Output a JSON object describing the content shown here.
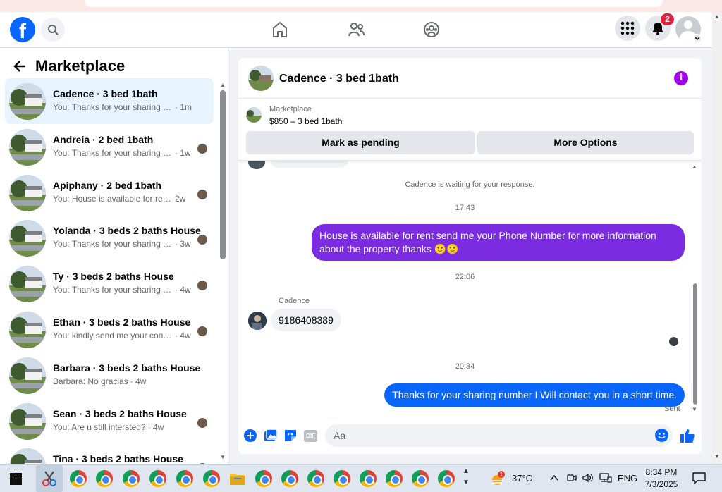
{
  "nav": {
    "logo": "f",
    "notification_count": "2"
  },
  "sidebar": {
    "title": "Marketplace",
    "conversations": [
      {
        "title": "Cadence · 3 bed 1bath",
        "preview": "You: Thanks for your sharing num...",
        "time": "· 1m",
        "active": true
      },
      {
        "title": "Andreia · 2 bed 1bath",
        "preview": "You: Thanks for your sharing nu...",
        "time": "· 1w"
      },
      {
        "title": "Apiphany · 2 bed 1bath",
        "preview": "You: House is available for rent sen...",
        "time": "2w"
      },
      {
        "title": "Yolanda · 3 beds 2 baths House",
        "preview": "You: Thanks for your sharing nu...",
        "time": "· 3w"
      },
      {
        "title": "Ty · 3 beds 2 baths House",
        "preview": "You: Thanks for your sharing nu...",
        "time": "· 4w"
      },
      {
        "title": "Ethan · 3 beds 2 baths House",
        "preview": "You: kindly send me your conta...",
        "time": "· 4w"
      },
      {
        "title": "Barbara · 3 beds 2 baths House",
        "preview": "Barbara: No gracias",
        "time": "· 4w"
      },
      {
        "title": "Sean · 3 beds 2 baths House",
        "preview": "You: Are u still intersted?",
        "time": "· 4w"
      },
      {
        "title": "Tina · 3 beds 2 baths House",
        "preview": "",
        "time": ""
      }
    ]
  },
  "chat": {
    "header_title": "Cadence · 3 bed 1bath",
    "listing_label": "Marketplace",
    "listing_price": "$850 – 3 bed 1bath",
    "mark_pending_label": "Mark as pending",
    "more_options_label": "More Options",
    "waiting_text": "Cadence is waiting for your response.",
    "messages": {
      "time1": "17:43",
      "out1": "House is available for rent send me your Phone Number for more information about the property thanks 🙂🙂",
      "time2": "22:06",
      "sender": "Cadence",
      "in1": "9186408389",
      "time3": "20:34",
      "out2": "Thanks for your sharing number I Will contact you in a short time.",
      "status": "Sent"
    },
    "composer_placeholder": "Aa",
    "gif_label": "GIF",
    "info_label": "i"
  },
  "taskbar": {
    "temperature": "37°C",
    "language": "ENG",
    "time": "8:34 PM",
    "date": "7/3/2025",
    "weather_badge": "1"
  },
  "colors": {
    "fb_blue": "#0866ff",
    "outgoing_purple": "#7b2be0",
    "active_row": "#e7f3ff"
  }
}
